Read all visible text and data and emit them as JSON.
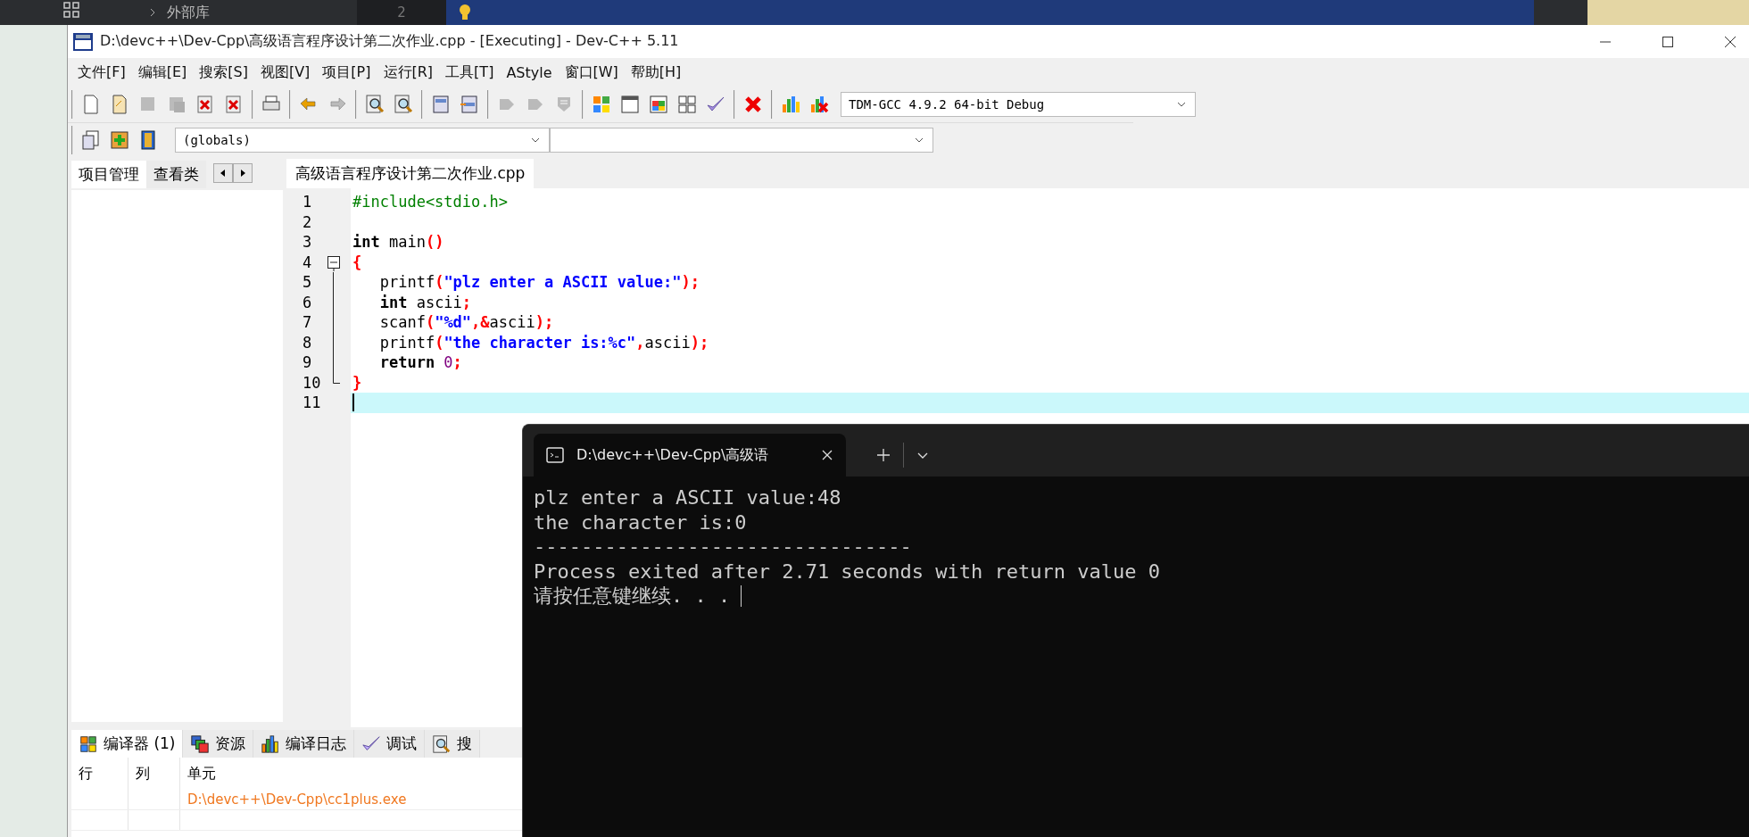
{
  "background_ide": {
    "tree_item": "外部库",
    "line_number": "2"
  },
  "window": {
    "title": "D:\\devc++\\Dev-Cpp\\高级语言程序设计第二次作业.cpp - [Executing] - Dev-C++ 5.11"
  },
  "menu": [
    "文件[F]",
    "编辑[E]",
    "搜索[S]",
    "视图[V]",
    "项目[P]",
    "运行[R]",
    "工具[T]",
    "AStyle",
    "窗口[W]",
    "帮助[H]"
  ],
  "toolbar": {
    "groups": [
      [
        {
          "kind": "page",
          "disabled": false
        },
        {
          "kind": "page-fold",
          "disabled": false
        },
        {
          "kind": "floppy",
          "disabled": true
        },
        {
          "kind": "floppies",
          "disabled": true
        },
        {
          "kind": "doc-x",
          "disabled": false
        },
        {
          "kind": "doc-x",
          "disabled": false
        }
      ],
      [
        {
          "kind": "printer",
          "disabled": false
        }
      ],
      [
        {
          "kind": "arrow-back",
          "disabled": false
        },
        {
          "kind": "arrow-forward",
          "disabled": true
        }
      ],
      [
        {
          "kind": "magnifier",
          "disabled": false
        },
        {
          "kind": "magnifier",
          "disabled": false
        }
      ],
      [
        {
          "kind": "panel",
          "disabled": false
        },
        {
          "kind": "panel-split",
          "disabled": false
        }
      ],
      [
        {
          "kind": "tag",
          "disabled": true
        },
        {
          "kind": "tag",
          "disabled": true
        },
        {
          "kind": "shield",
          "disabled": true
        }
      ],
      [
        {
          "kind": "color-grid",
          "disabled": false
        },
        {
          "kind": "window",
          "disabled": false
        },
        {
          "kind": "color-window",
          "disabled": false
        },
        {
          "kind": "grid",
          "disabled": false
        },
        {
          "kind": "check",
          "disabled": false
        }
      ],
      [
        {
          "kind": "red-x",
          "disabled": false
        }
      ],
      [
        {
          "kind": "bar-chart",
          "disabled": false
        },
        {
          "kind": "chart-x",
          "disabled": false
        }
      ]
    ],
    "compiler_select": "TDM-GCC 4.9.2 64-bit Debug"
  },
  "toolbar2": {
    "buttons": [
      {
        "kind": "doc-arrow",
        "disabled": false
      },
      {
        "kind": "plus",
        "disabled": false
      },
      {
        "kind": "book",
        "disabled": false
      }
    ],
    "scope_select": "(globals)"
  },
  "left_panel": {
    "tabs": [
      {
        "label": "项目管理",
        "selected": true
      },
      {
        "label": "查看类",
        "selected": false
      }
    ]
  },
  "editor": {
    "tabs": [
      {
        "label": "高级语言程序设计第二次作业.cpp",
        "selected": true
      }
    ],
    "lines": [
      {
        "number": "1",
        "current": false,
        "kind": "plain",
        "tokens": [
          {
            "kind": "preprocessor",
            "text": "#include<stdio.h>"
          }
        ]
      },
      {
        "number": "2",
        "current": false,
        "kind": "plain"
      },
      {
        "number": "3",
        "current": false,
        "kind": "plain",
        "tokens": [
          {
            "kind": "keyword",
            "text": "int"
          },
          {
            "kind": "plain",
            "text": " main"
          },
          {
            "kind": "symbol",
            "text": "()"
          }
        ]
      },
      {
        "number": "4",
        "current": false,
        "kind": "fold-start",
        "tokens": [
          {
            "kind": "symbol",
            "text": "{"
          }
        ]
      },
      {
        "number": "5",
        "current": false,
        "kind": "fold-body",
        "tokens": [
          {
            "kind": "plain",
            "text": "   printf"
          },
          {
            "kind": "symbol",
            "text": "("
          },
          {
            "kind": "string",
            "text": "\"plz enter a ASCII value:\""
          },
          {
            "kind": "symbol",
            "text": ");"
          }
        ]
      },
      {
        "number": "6",
        "current": false,
        "kind": "fold-body",
        "tokens": [
          {
            "kind": "keyword",
            "text": "   int"
          },
          {
            "kind": "plain",
            "text": " ascii"
          },
          {
            "kind": "symbol",
            "text": ";"
          }
        ]
      },
      {
        "number": "7",
        "current": false,
        "kind": "fold-body",
        "tokens": [
          {
            "kind": "plain",
            "text": "   scanf"
          },
          {
            "kind": "symbol",
            "text": "("
          },
          {
            "kind": "string",
            "text": "\"%d\""
          },
          {
            "kind": "symbol",
            "text": ",&"
          },
          {
            "kind": "plain",
            "text": "ascii"
          },
          {
            "kind": "symbol",
            "text": ");"
          }
        ]
      },
      {
        "number": "8",
        "current": false,
        "kind": "fold-body",
        "tokens": [
          {
            "kind": "plain",
            "text": "   printf"
          },
          {
            "kind": "symbol",
            "text": "("
          },
          {
            "kind": "string",
            "text": "\"the character is:%c\""
          },
          {
            "kind": "symbol",
            "text": ","
          },
          {
            "kind": "plain",
            "text": "ascii"
          },
          {
            "kind": "symbol",
            "text": ");"
          }
        ]
      },
      {
        "number": "9",
        "current": false,
        "kind": "fold-body",
        "tokens": [
          {
            "kind": "keyword",
            "text": "   return "
          },
          {
            "kind": "number",
            "text": "0"
          },
          {
            "kind": "symbol",
            "text": ";"
          }
        ]
      },
      {
        "number": "10",
        "current": false,
        "kind": "fold-end",
        "tokens": [
          {
            "kind": "symbol",
            "text": "}"
          }
        ]
      },
      {
        "number": "11",
        "current": true,
        "kind": "plain"
      }
    ]
  },
  "bottom_panel": {
    "tabs": [
      {
        "label": "编译器 (1)",
        "selected": true
      },
      {
        "label": "资源",
        "selected": false
      },
      {
        "label": "编译日志",
        "selected": false
      },
      {
        "label": "调试",
        "selected": false
      },
      {
        "label": "搜",
        "selected": false
      }
    ],
    "columns": [
      "行",
      "列",
      "单元"
    ],
    "rows": [
      {
        "unit": "D:\\devc++\\Dev-Cpp\\cc1plus.exe"
      }
    ]
  },
  "console": {
    "tab_title": "D:\\devc++\\Dev-Cpp\\高级语",
    "lines": [
      {
        "text": "plz enter a ASCII value:48",
        "cursor": false
      },
      {
        "text": "the character is:0",
        "cursor": false
      },
      {
        "text": "--------------------------------",
        "cursor": false
      },
      {
        "text": "Process exited after 2.71 seconds with return value 0",
        "cursor": false
      },
      {
        "text": "请按任意键继续. . .",
        "cursor": true
      }
    ]
  }
}
